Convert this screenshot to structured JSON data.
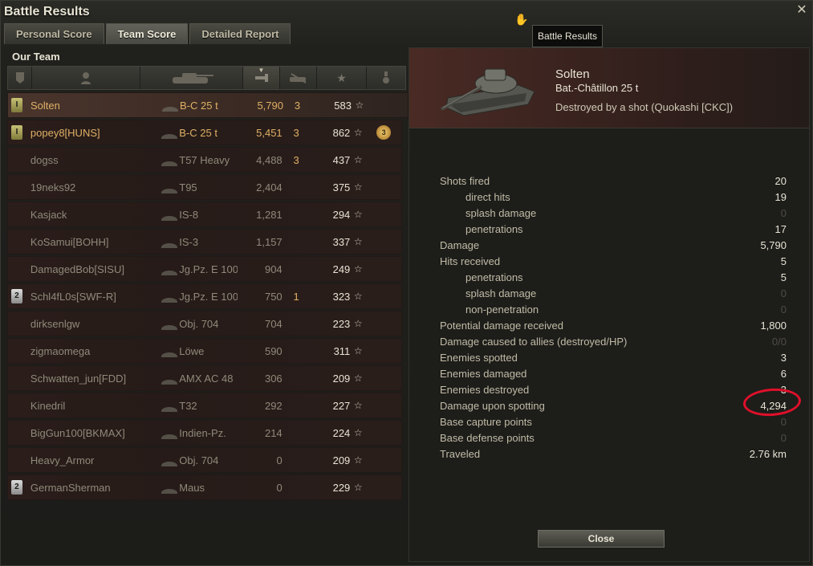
{
  "window": {
    "title": "Battle Results",
    "close_glyph": "✕"
  },
  "tooltip": "Battle Results",
  "tabs": [
    {
      "label": "Personal Score",
      "active": false
    },
    {
      "label": "Team Score",
      "active": true
    },
    {
      "label": "Detailed Report",
      "active": false
    }
  ],
  "team": {
    "title": "Our Team",
    "columns": [
      "platoon-icon",
      "player-icon",
      "vehicle-icon",
      "damage-icon",
      "kills-icon",
      "xp-star-icon",
      "medal-icon"
    ],
    "rows": [
      {
        "badge": "plat-1",
        "player": "Solten",
        "vehicle": "B-C 25 t",
        "damage": "5,790",
        "kills": "3",
        "xp": "583",
        "medal": ""
      },
      {
        "badge": "plat-1",
        "player": "popey8[HUNS]",
        "vehicle": "B-C 25 t",
        "damage": "5,451",
        "kills": "3",
        "xp": "862",
        "medal": "3"
      },
      {
        "badge": "",
        "player": "dogss",
        "vehicle": "T57 Heavy",
        "damage": "4,488",
        "kills": "3",
        "xp": "437",
        "medal": ""
      },
      {
        "badge": "",
        "player": "19neks92",
        "vehicle": "T95",
        "damage": "2,404",
        "kills": "",
        "xp": "375",
        "medal": ""
      },
      {
        "badge": "",
        "player": "Kasjack",
        "vehicle": "IS-8",
        "damage": "1,281",
        "kills": "",
        "xp": "294",
        "medal": ""
      },
      {
        "badge": "",
        "player": "KoSamui[BOHH]",
        "vehicle": "IS-3",
        "damage": "1,157",
        "kills": "",
        "xp": "337",
        "medal": ""
      },
      {
        "badge": "",
        "player": "DamagedBob[SISU]",
        "vehicle": "Jg.Pz. E 100",
        "damage": "904",
        "kills": "",
        "xp": "249",
        "medal": ""
      },
      {
        "badge": "plat-2",
        "player": "Schl4fL0s[SWF-R]",
        "vehicle": "Jg.Pz. E 100",
        "damage": "750",
        "kills": "1",
        "xp": "323",
        "medal": ""
      },
      {
        "badge": "",
        "player": "dirksenlgw",
        "vehicle": "Obj. 704",
        "damage": "704",
        "kills": "",
        "xp": "223",
        "medal": ""
      },
      {
        "badge": "",
        "player": "zigmaomega",
        "vehicle": "Löwe",
        "damage": "590",
        "kills": "",
        "xp": "311",
        "medal": ""
      },
      {
        "badge": "",
        "player": "Schwatten_jun[FDD]",
        "vehicle": "AMX AC 48",
        "damage": "306",
        "kills": "",
        "xp": "209",
        "medal": ""
      },
      {
        "badge": "",
        "player": "Kinedril",
        "vehicle": "T32",
        "damage": "292",
        "kills": "",
        "xp": "227",
        "medal": ""
      },
      {
        "badge": "",
        "player": "BigGun100[BKMAX]",
        "vehicle": "Indien-Pz.",
        "damage": "214",
        "kills": "",
        "xp": "224",
        "medal": ""
      },
      {
        "badge": "",
        "player": "Heavy_Armor",
        "vehicle": "Obj. 704",
        "damage": "0",
        "kills": "",
        "xp": "209",
        "medal": ""
      },
      {
        "badge": "plat-2",
        "player": "GermanSherman",
        "vehicle": "Maus",
        "damage": "0",
        "kills": "",
        "xp": "229",
        "medal": ""
      }
    ]
  },
  "details": {
    "player_name": "Solten",
    "vehicle_name": "Bat.-Châtillon 25 t",
    "fate": "Destroyed by a shot (Quokashi [CKC])",
    "stats": [
      {
        "label": "Shots fired",
        "value": "20",
        "sub": false,
        "muted": false
      },
      {
        "label": "direct hits",
        "value": "19",
        "sub": true,
        "muted": false
      },
      {
        "label": "splash damage",
        "value": "0",
        "sub": true,
        "muted": true
      },
      {
        "label": "penetrations",
        "value": "17",
        "sub": true,
        "muted": false
      },
      {
        "label": "Damage",
        "value": "5,790",
        "sub": false,
        "muted": false
      },
      {
        "label": "Hits received",
        "value": "5",
        "sub": false,
        "muted": false
      },
      {
        "label": "penetrations",
        "value": "5",
        "sub": true,
        "muted": false
      },
      {
        "label": "splash damage",
        "value": "0",
        "sub": true,
        "muted": true
      },
      {
        "label": "non-penetration",
        "value": "0",
        "sub": true,
        "muted": true
      },
      {
        "label": "Potential damage received",
        "value": "1,800",
        "sub": false,
        "muted": false
      },
      {
        "label": "Damage caused to allies (destroyed/HP)",
        "value": "0/0",
        "sub": false,
        "muted": true
      },
      {
        "label": "Enemies spotted",
        "value": "3",
        "sub": false,
        "muted": false
      },
      {
        "label": "Enemies damaged",
        "value": "6",
        "sub": false,
        "muted": false
      },
      {
        "label": "Enemies destroyed",
        "value": "3",
        "sub": false,
        "muted": false
      },
      {
        "label": "Damage upon spotting",
        "value": "4,294",
        "sub": false,
        "muted": false
      },
      {
        "label": "Base capture points",
        "value": "0",
        "sub": false,
        "muted": true
      },
      {
        "label": "Base defense points",
        "value": "0",
        "sub": false,
        "muted": true
      },
      {
        "label": "Traveled",
        "value": "2.76 km",
        "sub": false,
        "muted": false
      }
    ],
    "close_label": "Close"
  }
}
